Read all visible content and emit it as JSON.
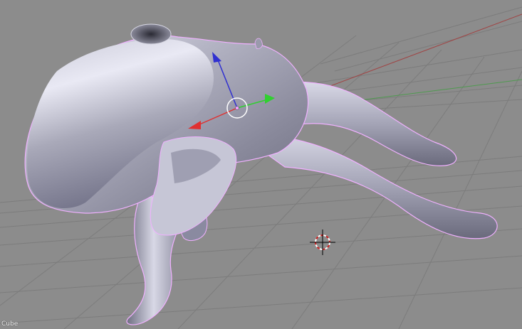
{
  "viewport": {
    "object_name": "Cube",
    "background_color": "#8c8c8c",
    "grid_color": "#7a7a7a",
    "x_axis_color": "#a04545",
    "y_axis_color": "#4f9a4f",
    "selection_outline_color": "#f0b0ff"
  },
  "mesh": {
    "shape": "smooth sculpted creature-like mesh with three tentacle limbs",
    "material_color": "#9b9baa",
    "selected": true
  },
  "manipulator": {
    "type": "translate",
    "x_handle_color": "#e03030",
    "y_handle_color": "#30d030",
    "z_handle_color": "#3030d0"
  },
  "cursor": {
    "type": "3d-cursor",
    "colors": [
      "#cc2222",
      "#ffffff",
      "#000000"
    ]
  }
}
